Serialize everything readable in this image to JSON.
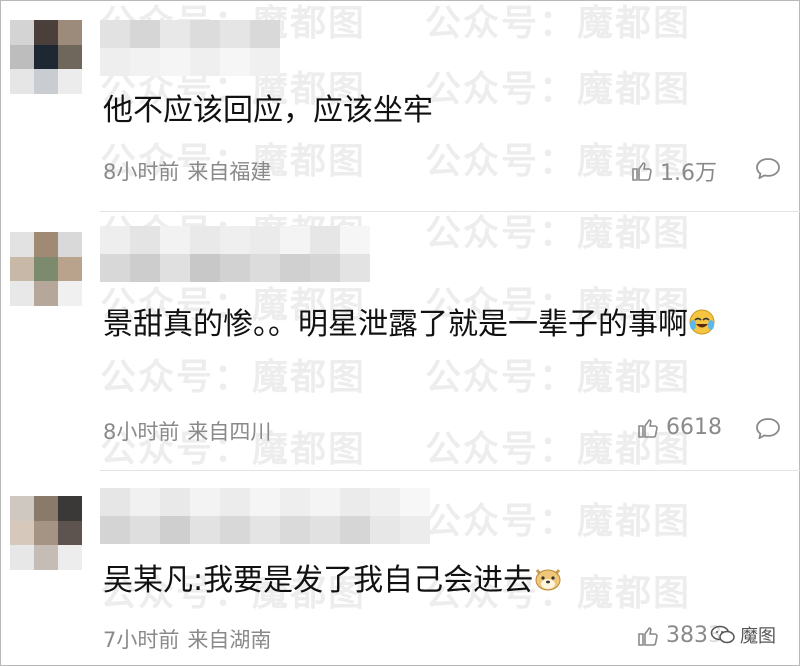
{
  "watermark": "公众号：魔都图",
  "comments": [
    {
      "text": "他不应该回应，应该坐牢",
      "time": "8小时前",
      "location": "来自福建",
      "likes": "1.6万"
    },
    {
      "text": "景甜真的惨。。明星泄露了就是一辈子的事啊",
      "time": "8小时前",
      "location": "来自四川",
      "likes": "6618"
    },
    {
      "text": "吴某凡:我要是发了我自己会进去",
      "time": "7小时前",
      "location": "来自湖南",
      "likes": "3833"
    }
  ],
  "wechat_tag": "魔图",
  "icons": {
    "like": "thumbs-up-icon",
    "reply": "speech-bubble-icon",
    "crying_emoji": "laugh-cry-emoji",
    "doge_emoji": "doge-emoji",
    "wechat": "wechat-icon"
  },
  "colors": {
    "meta": "#8a8a8a",
    "text": "#111111",
    "divider": "#e3e3e3"
  }
}
